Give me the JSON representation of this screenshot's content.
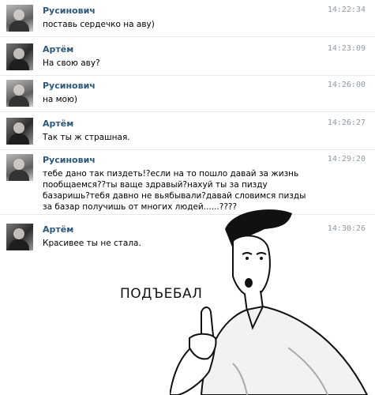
{
  "messages": [
    {
      "sender": "Русинович",
      "time": "14:22:34",
      "text": "поставь сердечко на аву)"
    },
    {
      "sender": "Артём",
      "time": "14:23:09",
      "text": "На свою аву?"
    },
    {
      "sender": "Русинович",
      "time": "14:26:00",
      "text": "на мою)"
    },
    {
      "sender": "Артём",
      "time": "14:26:27",
      "text": "Так ты ж страшная."
    },
    {
      "sender": "Русинович",
      "time": "14:29:20",
      "text": "тебе дано так пиздеть!?если на то пошло давай за жизнь пообщаемся??ты ваще здравый?нахуй ты за пизду базаришь?тебя давно не вьябывали?давай словимся пизды за базар получишь от многих людей......????"
    },
    {
      "sender": "Артём",
      "time": "14:30:26",
      "text": "Красивее ты не стала."
    }
  ],
  "meme": {
    "caption": "ПОДЪЕБАЛ"
  }
}
